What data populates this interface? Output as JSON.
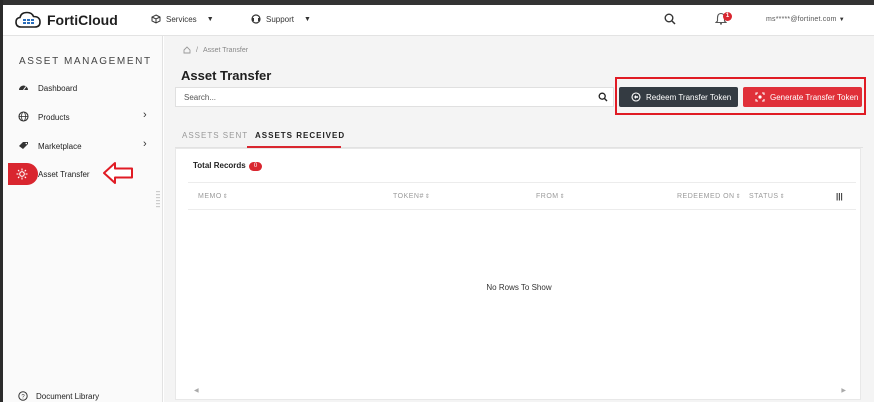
{
  "header": {
    "logo_text": "FortiCloud",
    "services_label": "Services",
    "support_label": "Support",
    "notification_count": "1",
    "user_email": "ms*****@fortinet.com"
  },
  "sidebar": {
    "section_title": "ASSET MANAGEMENT",
    "items": [
      {
        "label": "Dashboard",
        "icon": "speedometer-icon"
      },
      {
        "label": "Products",
        "icon": "globe-icon"
      },
      {
        "label": "Marketplace",
        "icon": "tag-icon"
      },
      {
        "label": "Asset Transfer",
        "icon": "transfer-icon"
      }
    ],
    "footer_label": "Document Library"
  },
  "breadcrumb": {
    "current": "Asset Transfer"
  },
  "page": {
    "title": "Asset Transfer",
    "search_placeholder": "Search...",
    "redeem_button": "Redeem Transfer Token",
    "generate_button": "Generate Transfer Token"
  },
  "tabs": {
    "sent": "ASSETS SENT",
    "received": "ASSETS RECEIVED",
    "active": "received"
  },
  "table": {
    "total_records_label": "Total Records",
    "total_records_count": "0",
    "columns": [
      "MEMO",
      "TOKEN#",
      "FROM",
      "REDEEMED ON",
      "STATUS"
    ],
    "empty_message": "No Rows To Show"
  },
  "colors": {
    "accent_red": "#d9262f",
    "dark_button": "#343b42",
    "highlight_box": "#e01b24"
  }
}
